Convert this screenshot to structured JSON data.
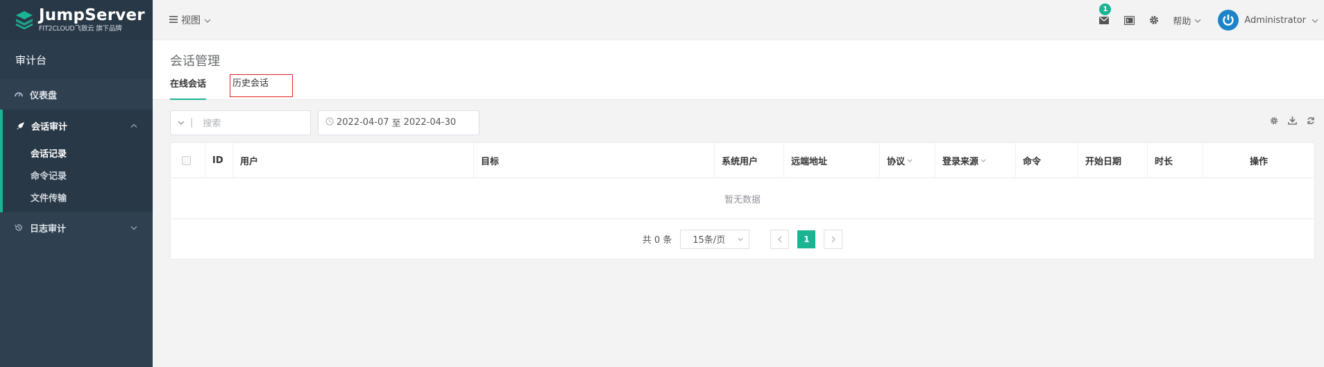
{
  "brand": {
    "name": "JumpServer",
    "sub": "FIT2CLOUD飞致云 旗下品牌"
  },
  "sidebar": {
    "console": "审计台",
    "dashboard": "仪表盘",
    "session_audit": {
      "label": "会话审计",
      "items": [
        "会话记录",
        "命令记录",
        "文件传输"
      ]
    },
    "log_audit": "日志审计"
  },
  "header": {
    "view_menu": "视图",
    "mail_badge": "1",
    "help": "帮助",
    "user": "Administrator"
  },
  "page": {
    "title": "会话管理",
    "tabs": [
      "在线会话",
      "历史会话"
    ]
  },
  "filter": {
    "search_placeholder": "搜索",
    "date_from": "2022-04-07",
    "date_sep": "至",
    "date_to": "2022-04-30"
  },
  "table": {
    "columns": [
      "ID",
      "用户",
      "目标",
      "系统用户",
      "远端地址",
      "协议",
      "登录来源",
      "命令",
      "开始日期",
      "时长",
      "操作"
    ],
    "empty_text": "暂无数据"
  },
  "pagination": {
    "total": "共 0 条",
    "page_size": "15条/页",
    "current_page": "1"
  },
  "colors": {
    "accent": "#1ab394",
    "sidebar": "#2f4050",
    "highlight": "#e02020"
  }
}
